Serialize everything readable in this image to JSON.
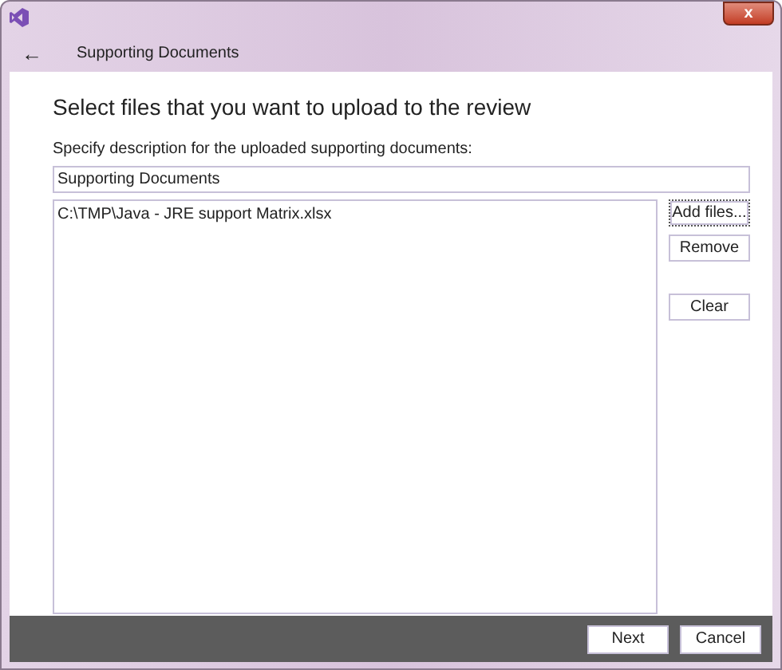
{
  "window": {
    "close": "x"
  },
  "header": {
    "back": "←",
    "title": "Supporting Documents"
  },
  "heading": "Select files that you want to upload to the review",
  "description": {
    "label": "Specify description for the uploaded supporting documents:",
    "value": "Supporting Documents"
  },
  "files": [
    "C:\\TMP\\Java - JRE support Matrix.xlsx"
  ],
  "side_buttons": [
    {
      "label": "Add files...",
      "focused": true
    },
    {
      "label": "Remove",
      "focused": false
    },
    {
      "label": "Clear",
      "focused": false
    }
  ],
  "footer_buttons": [
    "Next",
    "Cancel"
  ]
}
